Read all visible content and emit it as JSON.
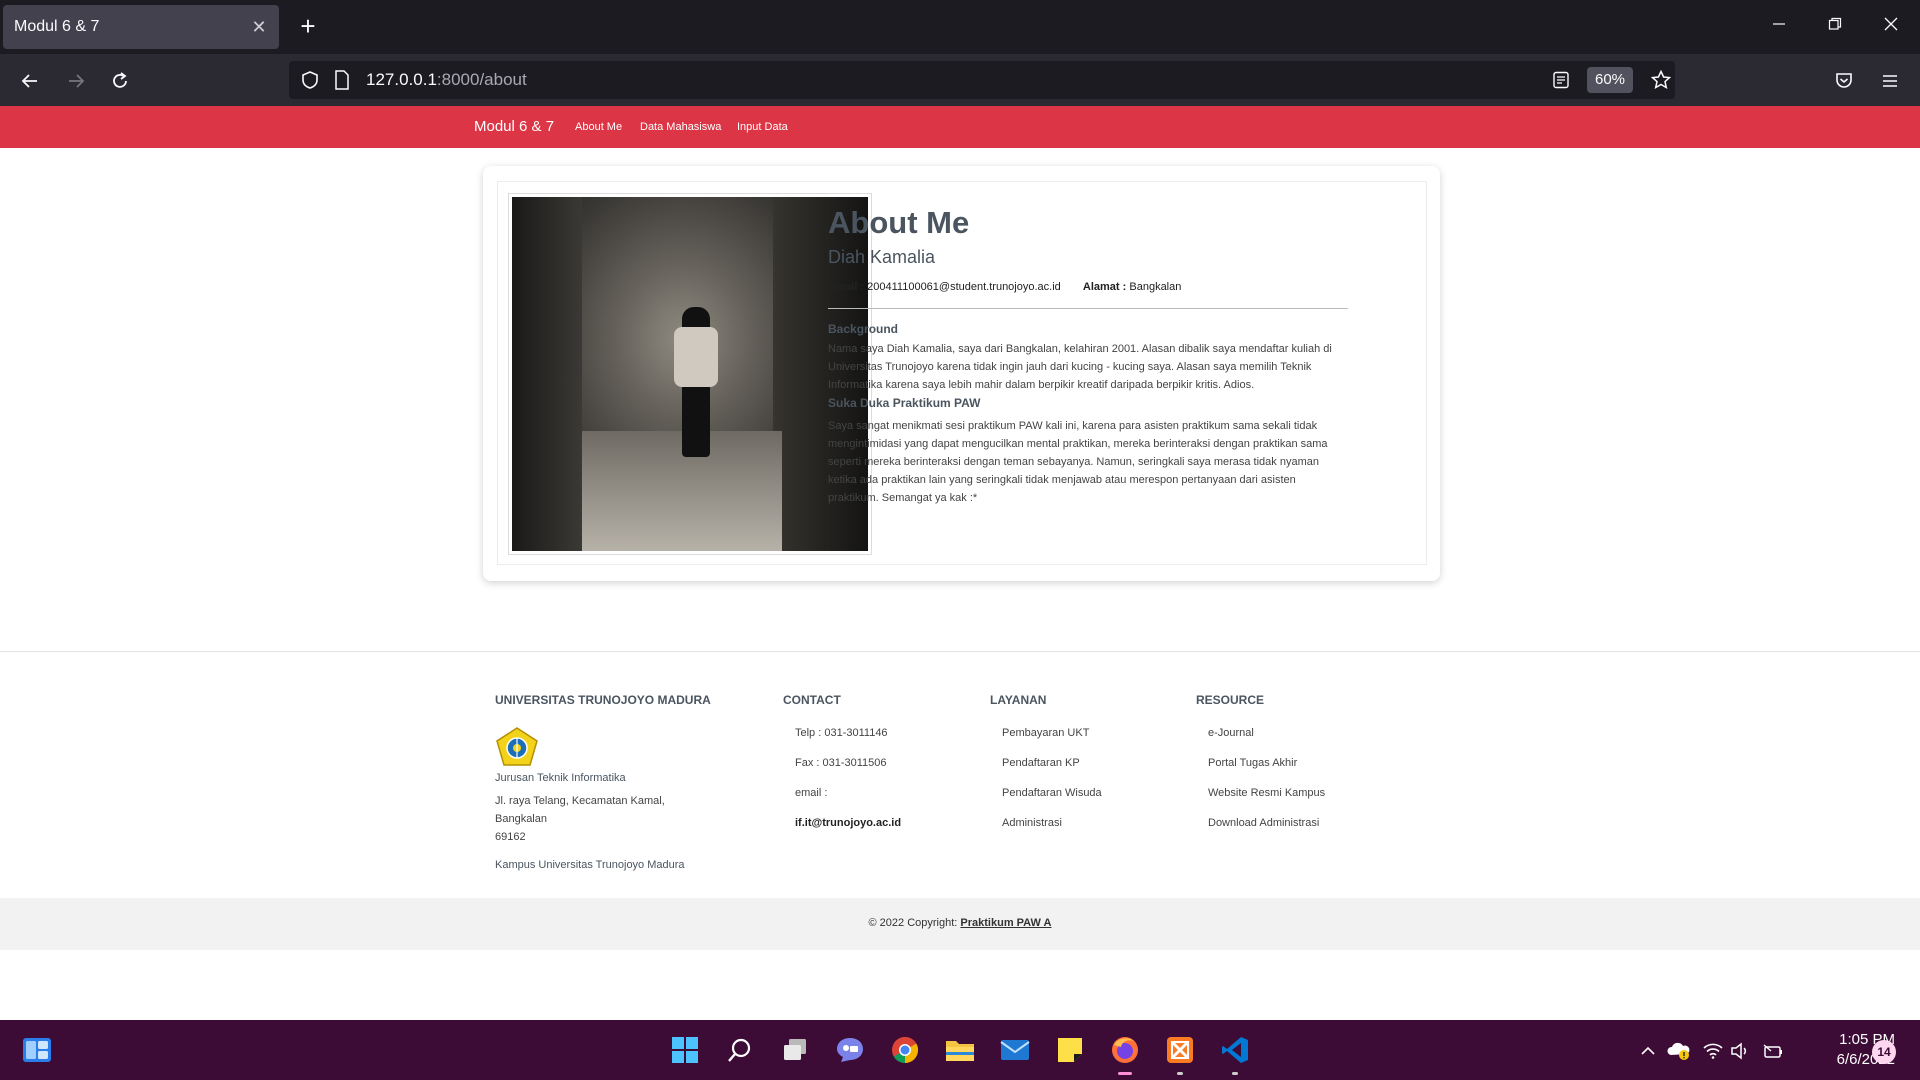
{
  "browser": {
    "tab_title": "Modul 6 & 7",
    "url_host": "127.0.0.1",
    "url_rest": ":8000/about",
    "zoom": "60%"
  },
  "site": {
    "brand": "Modul 6 & 7",
    "nav": [
      "About Me",
      "Data Mahasiswa",
      "Input Data"
    ]
  },
  "about": {
    "title": "About Me",
    "name": "Diah Kamalia",
    "email_label": "Email :",
    "email": "200411100061@student.trunojoyo.ac.id",
    "address_label": "Alamat :",
    "address": "Bangkalan",
    "background_title": "Background",
    "background_text": "Nama saya Diah Kamalia, saya dari Bangkalan, kelahiran 2001. Alasan dibalik saya mendaftar kuliah di Universitas Trunojoyo karena tidak ingin jauh dari kucing - kucing saya. Alasan saya memilih Teknik Informatika karena saya lebih mahir dalam berpikir kreatif daripada berpikir kritis. Adios.",
    "sukaduka_title": "Suka Duka Praktikum PAW",
    "sukaduka_text": "Saya sangat menikmati sesi praktikum PAW kali ini, karena para asisten praktikum sama sekali tidak mengintimidasi yang dapat mengucilkan mental praktikan, mereka berinteraksi dengan praktikan sama seperti mereka berinteraksi dengan teman sebayanya. Namun, seringkali saya merasa tidak nyaman ketika ada praktikan lain yang seringkali tidak menjawab atau merespon pertanyaan dari asisten praktikum. Semangat ya kak :*"
  },
  "footer": {
    "univ": {
      "title": "UNIVERSITAS TRUNOJOYO MADURA",
      "dept": "Jurusan Teknik Informatika",
      "addr1": "Jl. raya Telang, Kecamatan Kamal,",
      "addr2": "Bangkalan",
      "zip": "69162",
      "campus": "Kampus Universitas Trunojoyo Madura"
    },
    "contact": {
      "title": "CONTACT",
      "telp": "Telp : 031-3011146",
      "fax": "Fax : 031-3011506",
      "email_label": "email :",
      "email": "if.it@trunojoyo.ac.id"
    },
    "layanan": {
      "title": "LAYANAN",
      "items": [
        "Pembayaran UKT",
        "Pendaftaran KP",
        "Pendaftaran Wisuda",
        "Administrasi"
      ]
    },
    "resource": {
      "title": "RESOURCE",
      "items": [
        "e-Journal",
        "Portal Tugas Akhir",
        "Website Resmi Kampus",
        "Download Administrasi"
      ]
    },
    "copyright": "© 2022 Copyright:",
    "copyright_link": "Praktikum PAW A"
  },
  "taskbar": {
    "time": "1:05 PM",
    "date": "6/6/2022",
    "notifications": "14"
  },
  "colors": {
    "site_nav": "#dc3545",
    "taskbar": "#3c0b36"
  }
}
